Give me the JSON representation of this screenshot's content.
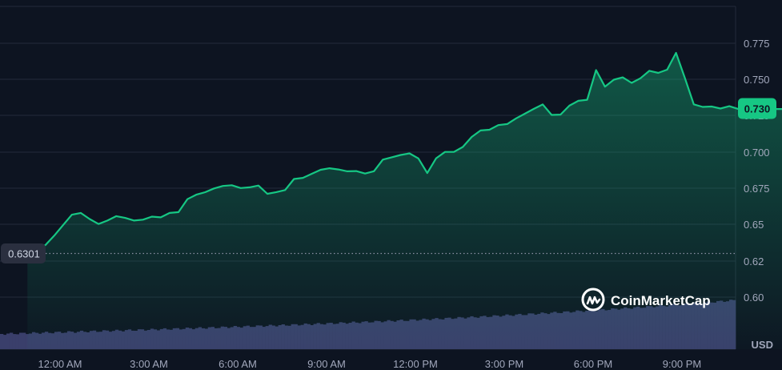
{
  "chart_data": {
    "type": "area",
    "unit": "USD",
    "x_tick_labels": [
      "12:00 AM",
      "3:00 AM",
      "6:00 AM",
      "9:00 AM",
      "12:00 PM",
      "3:00 PM",
      "6:00 PM",
      "9:00 PM"
    ],
    "y_tick_labels": [
      "0.60",
      "0.62",
      "0.65",
      "0.675",
      "0.700",
      "0.725",
      "0.750",
      "0.775"
    ],
    "y_ticks": [
      0.6,
      0.625,
      0.65,
      0.675,
      0.7,
      0.725,
      0.75,
      0.775
    ],
    "ylim": [
      0.6,
      0.8
    ],
    "xlim": [
      -1.1,
      24.5
    ],
    "current_price_label": "0.730",
    "current_price": 0.73,
    "open_price_label": "0.6301",
    "open_price": 0.6301,
    "grid": true,
    "series": [
      {
        "x": [
          -1.1,
          -0.8,
          -0.5,
          -0.2,
          0.1,
          0.4,
          0.7,
          1.0,
          1.3,
          1.6,
          1.9,
          2.2,
          2.5,
          2.8,
          3.1,
          3.4,
          3.7,
          4.0,
          4.3,
          4.6,
          4.9,
          5.2,
          5.5,
          5.8,
          6.1,
          6.4,
          6.7,
          7.0,
          7.3,
          7.6,
          7.9,
          8.2,
          8.5,
          8.8,
          9.1,
          9.4,
          9.7,
          10.0,
          10.3,
          10.6,
          10.9,
          11.2,
          11.5,
          11.8,
          12.1,
          12.4,
          12.7,
          13.0,
          13.3,
          13.6,
          13.9,
          14.2,
          14.5,
          14.8,
          15.1,
          15.4,
          15.7,
          16.0,
          16.3,
          16.6,
          16.9,
          17.2,
          17.5,
          17.8,
          18.1,
          18.4,
          18.7,
          19.0,
          19.3,
          19.6,
          19.9,
          20.2,
          20.5,
          20.8,
          21.1,
          21.4,
          21.7,
          22.0,
          22.3,
          22.6,
          22.9,
          23.2,
          23.5,
          23.8,
          24.1,
          24.5
        ],
        "values": [
          0.6334,
          0.6355,
          0.6358,
          0.6423,
          0.6496,
          0.6568,
          0.658,
          0.6538,
          0.6504,
          0.6528,
          0.6558,
          0.6546,
          0.6528,
          0.6534,
          0.6555,
          0.655,
          0.658,
          0.6586,
          0.6675,
          0.6706,
          0.6723,
          0.6749,
          0.6766,
          0.6771,
          0.6752,
          0.6757,
          0.6769,
          0.6712,
          0.6724,
          0.6738,
          0.6814,
          0.6822,
          0.685,
          0.6878,
          0.6888,
          0.688,
          0.6867,
          0.6869,
          0.6852,
          0.6868,
          0.6948,
          0.6964,
          0.698,
          0.6991,
          0.6956,
          0.6855,
          0.6957,
          0.7001,
          0.7001,
          0.7035,
          0.7104,
          0.7149,
          0.7154,
          0.7186,
          0.7193,
          0.7232,
          0.7265,
          0.7298,
          0.7328,
          0.7256,
          0.7258,
          0.732,
          0.7353,
          0.736,
          0.7565,
          0.7451,
          0.7499,
          0.7515,
          0.7477,
          0.7509,
          0.756,
          0.7546,
          0.7568,
          0.7684,
          0.751,
          0.7329,
          0.7311,
          0.7314,
          0.73,
          0.7316,
          0.7297,
          0.7297,
          0.7297,
          0.7297,
          0.7297,
          0.7297
        ]
      }
    ],
    "volume_note": ""
  },
  "branding": {
    "logo_text": "CoinMarketCap"
  },
  "colors": {
    "background": "#0d1421",
    "line": "#16c784",
    "area_top": "#16c784",
    "grid": "#222a3b",
    "volume": "#3a3f6b",
    "badge": "#16c784",
    "open_badge": "#2a2f3f"
  }
}
